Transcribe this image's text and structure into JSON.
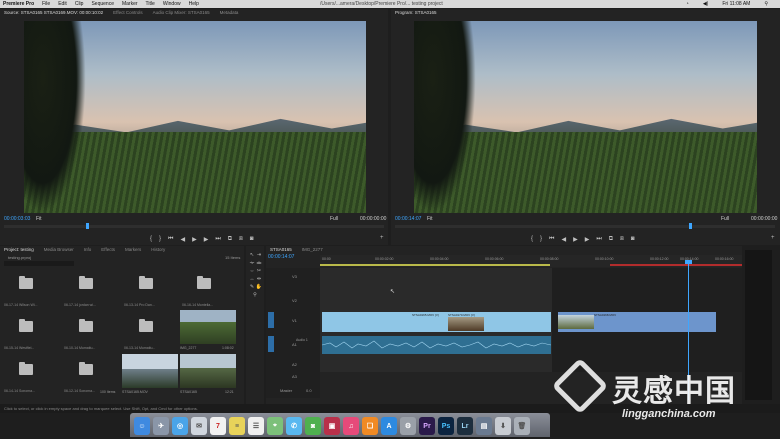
{
  "menubar": {
    "app": "Premiere Pro",
    "items": [
      "File",
      "Edit",
      "Clip",
      "Sequence",
      "Marker",
      "Title",
      "Window",
      "Help"
    ],
    "doc_title": "/Users/...amera/Desktop/Premiere Pro/... testing project",
    "clock": "Fri 11:08 AM"
  },
  "source": {
    "tabs": [
      "Source: STSA0165 STSA0169.MOV: 00:00:10:02",
      "Effect Controls",
      "Audio Clip Mixer: STSA0165",
      "Metadata"
    ],
    "timecode": "00:00:03:03",
    "fit": "Fit",
    "full": "Full",
    "end_time": "00:00:00:00"
  },
  "program": {
    "tabs": [
      "Program: STSA0165"
    ],
    "timecode": "00:00:14:07",
    "fit": "Fit",
    "full": "Full",
    "end_time": "00:00:00:00"
  },
  "project": {
    "tabs": [
      "Project: testing",
      "Media Browser",
      "Info",
      "Effects",
      "Markers",
      "History"
    ],
    "name": "testing.prproj",
    "items_count": "15 Items",
    "folders": [
      {
        "label": "06-17-14 Wilson Wi...",
        "count": "37 Items"
      },
      {
        "label": "06-17-14 jordan wi...",
        "count": "11 Items"
      },
      {
        "label": "06-13-14 Pro Dan...",
        "count": "11 Items"
      },
      {
        "label": "06-16-14 Montella...",
        "count": "70 Items"
      },
      {
        "label": "06-15-14 Westfiel...",
        "count": "11 Items"
      },
      {
        "label": "06-10-14 Mumatlu...",
        "count": "11 Items"
      },
      {
        "label": "06-13-14 Mumatlu...",
        "count": "11 Items"
      },
      {
        "label": "06-14-14 Sonoma...",
        "count": "11 Items"
      },
      {
        "label": "06-12-14 Sonoma...",
        "count": "11 Items"
      },
      {
        "label": "06-11-14 Sonoma...",
        "count": "100 Items"
      }
    ],
    "thumbs": [
      {
        "label": "IMG_2277",
        "dur": "1:08:02"
      },
      {
        "label": "STSA0165.MOV",
        "dur": "4:00"
      },
      {
        "label": "STSA0165",
        "dur": "12:21"
      }
    ]
  },
  "timeline": {
    "tabs": [
      "STSA0165",
      "IMG_2277"
    ],
    "timecode": "00:00:14:07",
    "ruler": [
      "00:00",
      "00:00:02:00",
      "00:00:04:00",
      "00:00:06:00",
      "00:00:08:00",
      "00:00:10:00",
      "00:00:12:00",
      "00:00:14:00",
      "00:00:16:00"
    ],
    "tracks": [
      "V3",
      "V2",
      "V1",
      "A1",
      "A2",
      "A3",
      "Master"
    ],
    "clips": [
      {
        "label": "STSA0165.MOV [V]"
      },
      {
        "label": "STSA0170.MOV [V]"
      },
      {
        "label": "STSA0168.MOV"
      }
    ],
    "audio_label": "Audio 1",
    "master_value": "0.0"
  },
  "status": "Click to select, or click in empty space and drag to marquee select. Use Shift, Opt, and Cmd for other options.",
  "watermark": {
    "cn": "灵感中国",
    "en": "lingganchina.com"
  }
}
